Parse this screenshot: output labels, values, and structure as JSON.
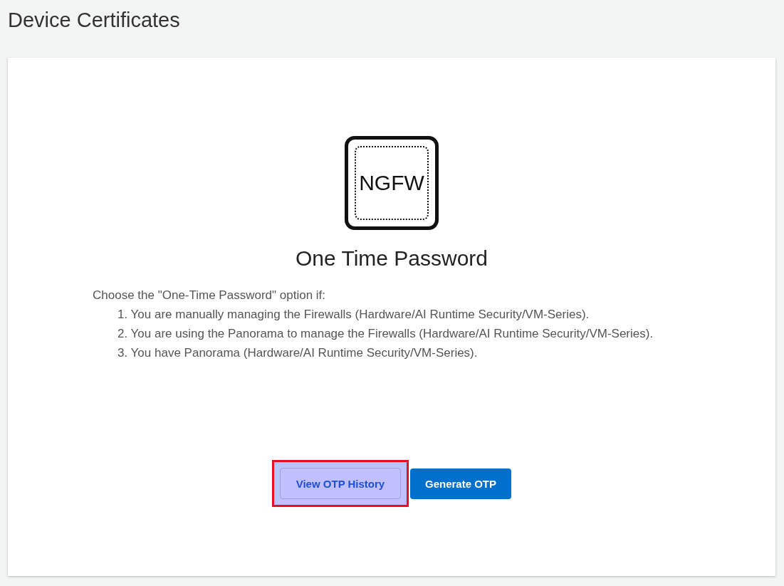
{
  "page": {
    "title": "Device Certificates"
  },
  "card": {
    "icon_label": "NGFW",
    "heading": "One Time Password",
    "intro": "Choose the \"One-Time Password\" option if:",
    "conditions": [
      "1. You are manually managing the Firewalls (Hardware/AI Runtime Security/VM-Series).",
      "2. You are using the Panorama to manage the Firewalls (Hardware/AI Runtime Security/VM-Series).",
      "3. You have Panorama (Hardware/AI Runtime Security/VM-Series)."
    ],
    "buttons": [
      {
        "label": "View OTP History",
        "kind": "secondary",
        "highlighted": true
      },
      {
        "label": "Generate OTP",
        "kind": "primary",
        "highlighted": false
      }
    ]
  }
}
